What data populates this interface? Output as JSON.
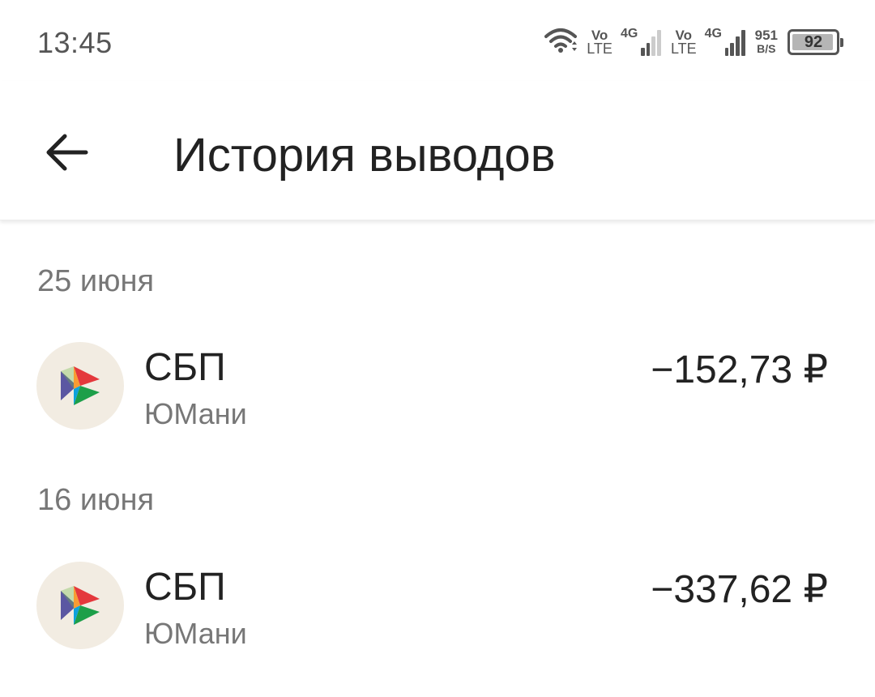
{
  "status_bar": {
    "time": "13:45",
    "sim1_vo": "Vo",
    "sim1_lte": "LTE",
    "sim1_net": "4G",
    "sim2_vo": "Vo",
    "sim2_lte": "LTE",
    "sim2_net": "4G",
    "speed_value": "951",
    "speed_unit": "B/S",
    "battery_level": "92",
    "icons": [
      "wifi-icon",
      "signal-icon",
      "signal-icon",
      "battery-icon"
    ]
  },
  "header": {
    "title": "История выводов",
    "back_icon": "arrow-left-icon"
  },
  "groups": [
    {
      "date": "25 июня",
      "items": [
        {
          "title": "СБП",
          "subtitle": "ЮМани",
          "amount": "−152,73 ₽",
          "icon": "sbp-logo-icon"
        }
      ]
    },
    {
      "date": "16 июня",
      "items": [
        {
          "title": "СБП",
          "subtitle": "ЮМани",
          "amount": "−337,62 ₽",
          "icon": "sbp-logo-icon"
        }
      ]
    }
  ],
  "colors": {
    "icon_background": "#f2ece2",
    "secondary_text": "#777777",
    "primary_text": "#222222"
  }
}
